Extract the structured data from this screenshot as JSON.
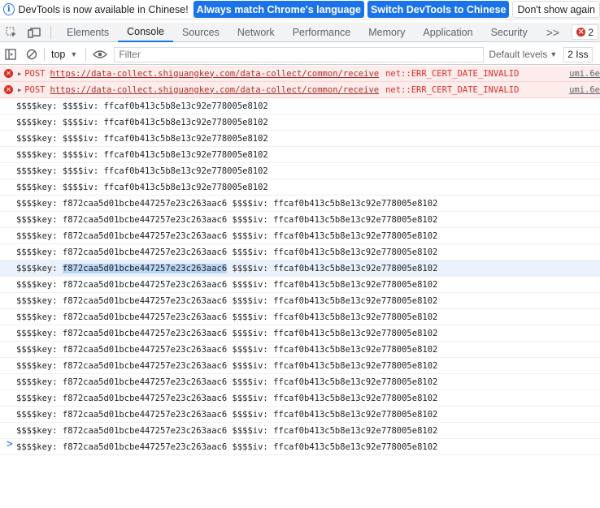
{
  "infobar": {
    "message": "DevTools is now available in Chinese!",
    "match_button": "Always match Chrome's language",
    "switch_button": "Switch DevTools to Chinese",
    "dismiss_button": "Don't show again"
  },
  "tabs": {
    "items": [
      "Elements",
      "Console",
      "Sources",
      "Network",
      "Performance",
      "Memory",
      "Application",
      "Security"
    ],
    "active": "Console",
    "more": ">>",
    "error_count": "2"
  },
  "toolbar": {
    "context": "top",
    "filter_placeholder": "Filter",
    "levels": "Default levels",
    "issues": "2 Iss"
  },
  "messages": {
    "errors": [
      {
        "method": "POST",
        "url": "https://data-collect.shiguangkey.com/data-collect/common/receive",
        "error": "net::ERR_CERT_DATE_INVALID",
        "source": "umi.6e"
      },
      {
        "method": "POST",
        "url": "https://data-collect.shiguangkey.com/data-collect/common/receive",
        "error": "net::ERR_CERT_DATE_INVALID",
        "source": "umi.6e"
      }
    ],
    "logs": [
      "$$$$key:  $$$$iv: ffcaf0b413c5b8e13c92e778005e8102",
      "$$$$key:  $$$$iv: ffcaf0b413c5b8e13c92e778005e8102",
      "$$$$key:  $$$$iv: ffcaf0b413c5b8e13c92e778005e8102",
      "$$$$key:  $$$$iv: ffcaf0b413c5b8e13c92e778005e8102",
      "$$$$key:  $$$$iv: ffcaf0b413c5b8e13c92e778005e8102",
      "$$$$key:  $$$$iv: ffcaf0b413c5b8e13c92e778005e8102",
      "$$$$key: f872caa5d01bcbe447257e23c263aac6 $$$$iv: ffcaf0b413c5b8e13c92e778005e8102",
      "$$$$key: f872caa5d01bcbe447257e23c263aac6 $$$$iv: ffcaf0b413c5b8e13c92e778005e8102",
      "$$$$key: f872caa5d01bcbe447257e23c263aac6 $$$$iv: ffcaf0b413c5b8e13c92e778005e8102",
      "$$$$key: f872caa5d01bcbe447257e23c263aac6 $$$$iv: ffcaf0b413c5b8e13c92e778005e8102",
      "$$$$key: f872caa5d01bcbe447257e23c263aac6 $$$$iv: ffcaf0b413c5b8e13c92e778005e8102",
      "$$$$key: f872caa5d01bcbe447257e23c263aac6 $$$$iv: ffcaf0b413c5b8e13c92e778005e8102",
      "$$$$key: f872caa5d01bcbe447257e23c263aac6 $$$$iv: ffcaf0b413c5b8e13c92e778005e8102",
      "$$$$key: f872caa5d01bcbe447257e23c263aac6 $$$$iv: ffcaf0b413c5b8e13c92e778005e8102",
      "$$$$key: f872caa5d01bcbe447257e23c263aac6 $$$$iv: ffcaf0b413c5b8e13c92e778005e8102",
      "$$$$key: f872caa5d01bcbe447257e23c263aac6 $$$$iv: ffcaf0b413c5b8e13c92e778005e8102",
      "$$$$key: f872caa5d01bcbe447257e23c263aac6 $$$$iv: ffcaf0b413c5b8e13c92e778005e8102",
      "$$$$key: f872caa5d01bcbe447257e23c263aac6 $$$$iv: ffcaf0b413c5b8e13c92e778005e8102",
      "$$$$key: f872caa5d01bcbe447257e23c263aac6 $$$$iv: ffcaf0b413c5b8e13c92e778005e8102",
      "$$$$key: f872caa5d01bcbe447257e23c263aac6 $$$$iv: ffcaf0b413c5b8e13c92e778005e8102",
      "$$$$key: f872caa5d01bcbe447257e23c263aac6 $$$$iv: ffcaf0b413c5b8e13c92e778005e8102",
      "$$$$key: f872caa5d01bcbe447257e23c263aac6 $$$$iv: ffcaf0b413c5b8e13c92e778005e8102"
    ],
    "selected_text": "f872caa5d01bcbe447257e23c263aac6"
  },
  "prompt": ">",
  "colors": {
    "accent": "#1a73e8",
    "error": "#d93025",
    "error_bg": "#fcecec",
    "selection": "#bad6f5"
  }
}
